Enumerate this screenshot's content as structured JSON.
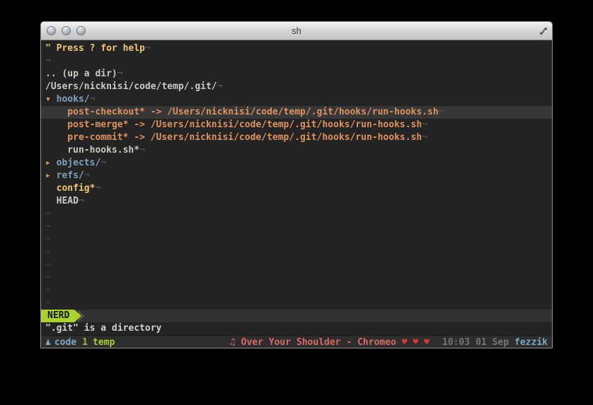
{
  "window": {
    "title": "sh"
  },
  "colors": {
    "bg": "#242424",
    "cursor_line": "#373737",
    "fg": "#c9cac6",
    "help_yellow": "#f0c674",
    "dir_blue": "#81a2be",
    "arrow_orange": "#e8a44f",
    "symlink_orange": "#de935f",
    "file_yellow": "#f0c674",
    "eol_gray": "#4f4f4f",
    "tilde_gray": "#3f3f3f",
    "nerd_green": "#a8d32f",
    "statusline_bg": "#323232",
    "chevron_gray": "#4c4c4c",
    "cmd_fg": "#d2d2d0",
    "tmux_bg": "#2d2d2d",
    "tmux_blue": "#7da8c3",
    "tmux_green": "#8fc049",
    "tmux_bright_green": "#a8d32f",
    "song_red": "#d96b66",
    "heart_red": "#e03434",
    "time_gray": "#757575",
    "host_cyan": "#7da8c3"
  },
  "editor": {
    "lines": [
      {
        "cells": [
          {
            "t": "\" Press ? for help",
            "c": "help"
          },
          {
            "t": "¬",
            "c": "eol"
          }
        ]
      },
      {
        "cells": [
          {
            "t": "¬",
            "c": "eol"
          }
        ]
      },
      {
        "cells": [
          {
            "t": ".. (up a dir)",
            "c": "plain"
          },
          {
            "t": "¬",
            "c": "eol"
          }
        ]
      },
      {
        "cells": [
          {
            "t": "/Users/nicknisi/code/temp/.git/",
            "c": "plain"
          },
          {
            "t": "¬",
            "c": "eol"
          }
        ]
      },
      {
        "cells": [
          {
            "t": "▾ ",
            "c": "arrow"
          },
          {
            "t": "hooks/",
            "c": "dir"
          },
          {
            "t": "¬",
            "c": "eol"
          }
        ]
      },
      {
        "hl": true,
        "cells": [
          {
            "t": "    post-checkout* -> /Users/nicknisi/code/temp/.git/hooks/run-hooks.sh",
            "c": "symlink"
          },
          {
            "t": "¬",
            "c": "eol"
          }
        ]
      },
      {
        "cells": [
          {
            "t": "    post-merge* -> /Users/nicknisi/code/temp/.git/hooks/run-hooks.sh",
            "c": "symlink"
          },
          {
            "t": "¬",
            "c": "eol"
          }
        ]
      },
      {
        "cells": [
          {
            "t": "    pre-commit* -> /Users/nicknisi/code/temp/.git/hooks/run-hooks.sh",
            "c": "symlink"
          },
          {
            "t": "¬",
            "c": "eol"
          }
        ]
      },
      {
        "cells": [
          {
            "t": "    run-hooks.sh*",
            "c": "plain"
          },
          {
            "t": "¬",
            "c": "eol"
          }
        ]
      },
      {
        "cells": [
          {
            "t": "▸ ",
            "c": "arrow"
          },
          {
            "t": "objects/",
            "c": "dir"
          },
          {
            "t": "¬",
            "c": "eol"
          }
        ]
      },
      {
        "cells": [
          {
            "t": "▸ ",
            "c": "arrow"
          },
          {
            "t": "refs/",
            "c": "dir"
          },
          {
            "t": "¬",
            "c": "eol"
          }
        ]
      },
      {
        "cells": [
          {
            "t": "  config*",
            "c": "yellow"
          },
          {
            "t": "¬",
            "c": "eol"
          }
        ]
      },
      {
        "cells": [
          {
            "t": "  HEAD",
            "c": "plain"
          },
          {
            "t": "¬",
            "c": "eol"
          }
        ]
      },
      {
        "cells": [
          {
            "t": "~",
            "c": "tilde"
          }
        ]
      },
      {
        "cells": [
          {
            "t": "~",
            "c": "tilde"
          }
        ]
      },
      {
        "cells": [
          {
            "t": "~",
            "c": "tilde"
          }
        ]
      },
      {
        "cells": [
          {
            "t": "~",
            "c": "tilde"
          }
        ]
      },
      {
        "cells": [
          {
            "t": "~",
            "c": "tilde"
          }
        ]
      },
      {
        "cells": [
          {
            "t": "~",
            "c": "tilde"
          }
        ]
      },
      {
        "cells": [
          {
            "t": "~",
            "c": "tilde"
          }
        ]
      },
      {
        "cells": [
          {
            "t": "~",
            "c": "tilde"
          }
        ]
      }
    ]
  },
  "statusline": {
    "mode": "NERD"
  },
  "cmdline": {
    "message": "\".git\" is a directory"
  },
  "tmux": {
    "session_icon": "♟",
    "session": "code",
    "window_index": "1",
    "window_name": "temp",
    "music_icon": "♫",
    "song": "Over Your Shoulder - Chromeo",
    "hearts": "♥ ♥ ♥",
    "time": "10:03",
    "date": "01 Sep",
    "host": "fezzik"
  }
}
